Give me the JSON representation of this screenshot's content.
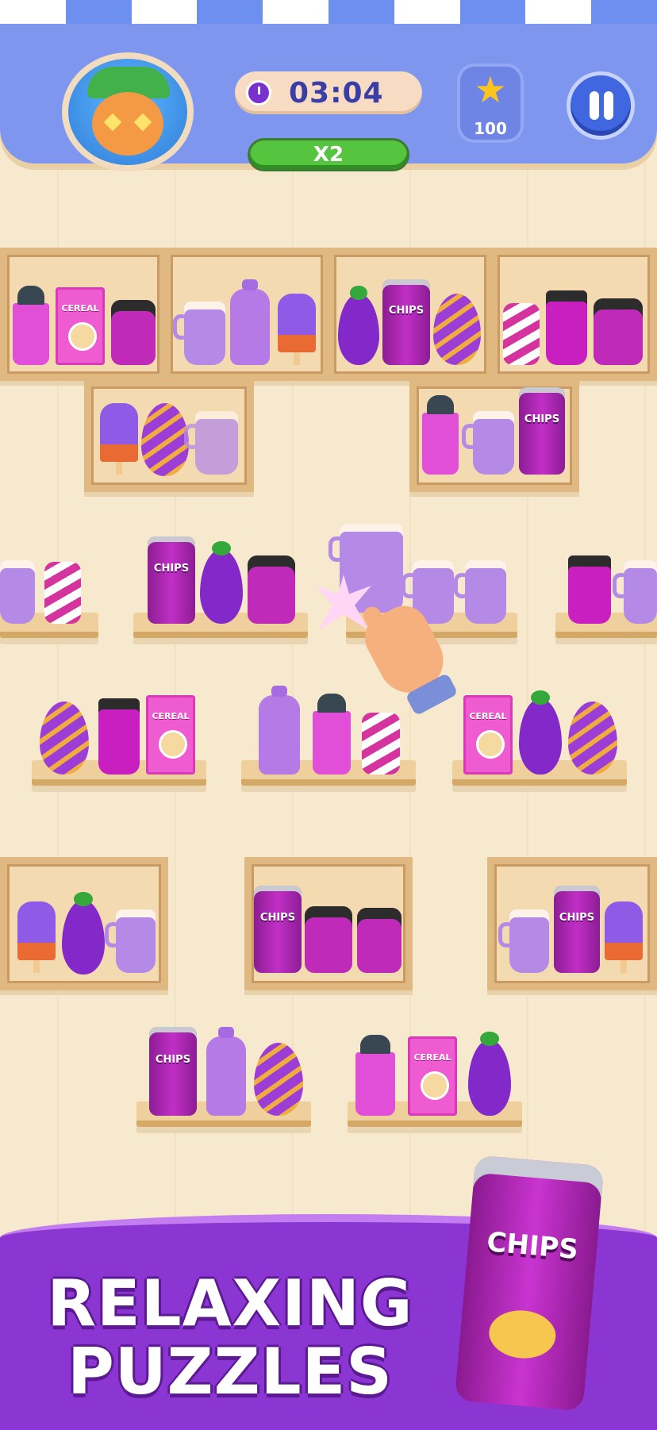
{
  "hud": {
    "timer": "03:04",
    "multiplier": "X2",
    "stars": "100"
  },
  "labels": {
    "chips": "CHIPS",
    "cereal": "CEREAL"
  },
  "banner": {
    "line1": "RELAXING",
    "line2": "PUZZLES",
    "can_label": "CHIPS"
  },
  "colors": {
    "purple": "#8b35d3",
    "blue_bar": "#7f96ee",
    "green_badge": "#55c43e",
    "star": "#ffc51d"
  },
  "icons": [
    "cat-avatar-icon",
    "timer-icon",
    "star-icon",
    "pause-icon",
    "hand-pointer-icon"
  ]
}
